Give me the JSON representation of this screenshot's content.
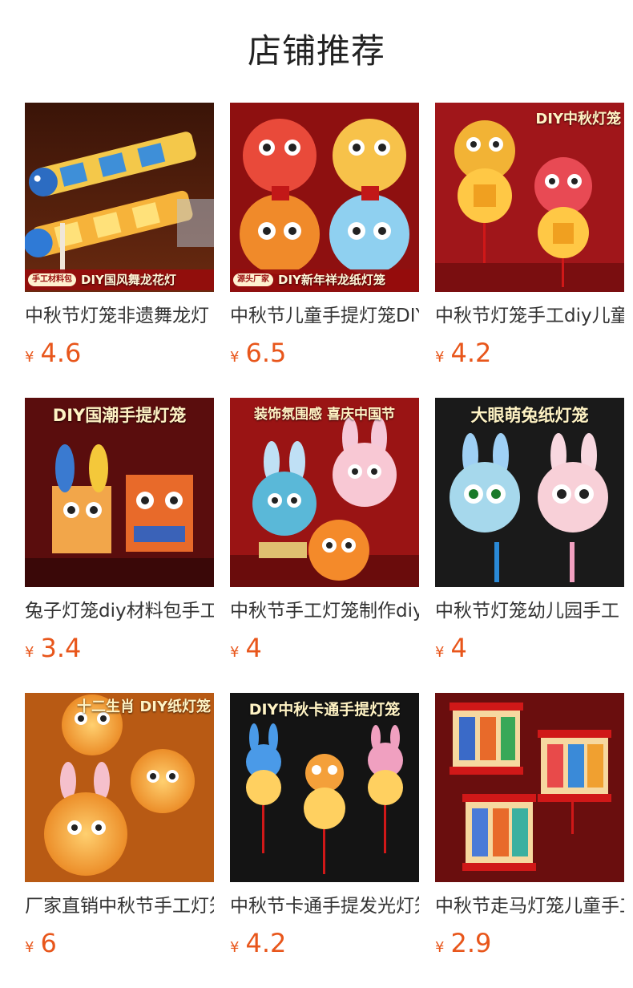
{
  "page": {
    "title": "店铺推荐",
    "currency_symbol": "¥"
  },
  "colors": {
    "price": "#e8561b",
    "title_text": "#333333",
    "thumb_bg": "#8a1212"
  },
  "products": [
    {
      "title": "中秋节灯笼非遗舞龙灯",
      "price": "4.6",
      "image_caption": "DIY国风舞龙花灯",
      "image_tag": "手工材料包"
    },
    {
      "title": "中秋节儿童手提灯笼DIY",
      "price": "6.5",
      "image_caption": "DIY新年祥龙纸灯笼",
      "image_tag": "源头厂家"
    },
    {
      "title": "中秋节灯笼手工diy儿童",
      "price": "4.2",
      "image_caption": "DIY中秋灯笼"
    },
    {
      "title": "兔子灯笼diy材料包手工",
      "price": "3.4",
      "image_caption": "DIY国潮手提灯笼"
    },
    {
      "title": "中秋节手工灯笼制作diy",
      "price": "4",
      "image_caption": "装饰氛围感 喜庆中国节"
    },
    {
      "title": "中秋节灯笼幼儿园手工",
      "price": "4",
      "image_caption": "大眼萌兔纸灯笼"
    },
    {
      "title": "厂家直销中秋节手工灯笼",
      "price": "6",
      "image_caption": "十二生肖 DIY纸灯笼"
    },
    {
      "title": "中秋节卡通手提发光灯笼",
      "price": "4.2",
      "image_caption": "DIY中秋卡通手提灯笼"
    },
    {
      "title": "中秋节走马灯笼儿童手工",
      "price": "2.9",
      "image_caption": ""
    }
  ]
}
